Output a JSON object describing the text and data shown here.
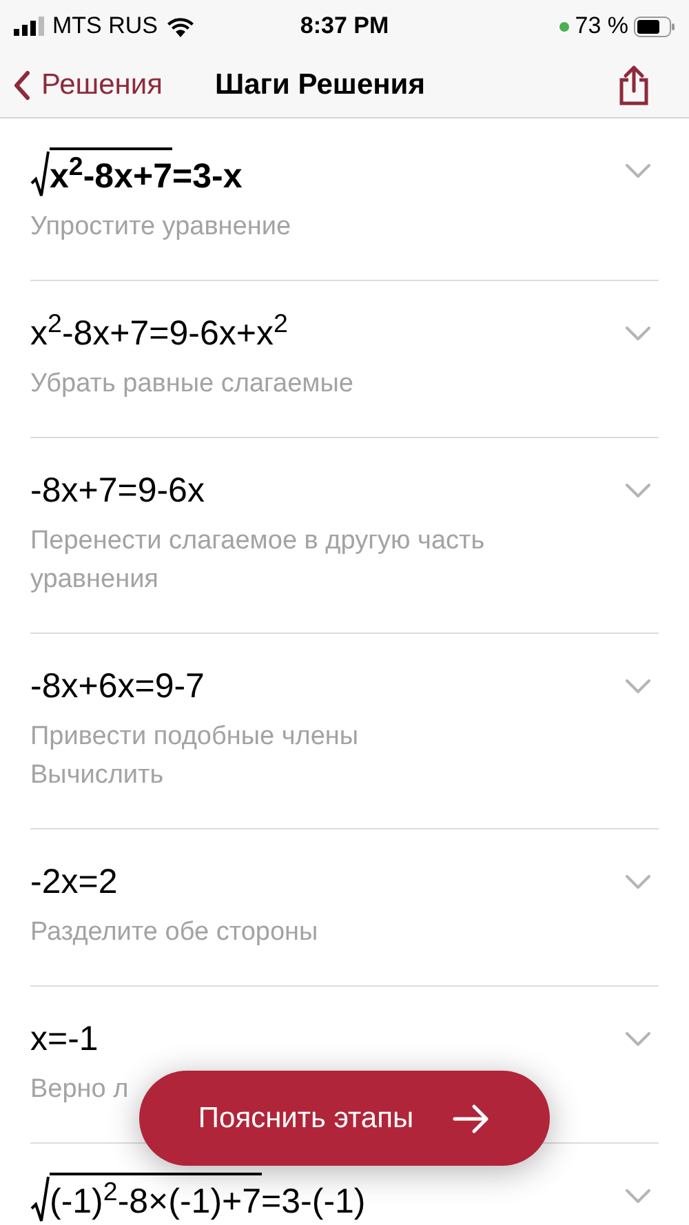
{
  "status_bar": {
    "carrier": "MTS RUS",
    "time": "8:37 PM",
    "battery": "73 %"
  },
  "nav": {
    "back": "Решения",
    "title": "Шаги Решения"
  },
  "steps": [
    {
      "radical": "x$^{2}$-8x+7",
      "equation": "=3-x",
      "bold": true,
      "description": "Упростите уравнение",
      "expanded": false
    },
    {
      "equation": "x$^{2}$-8x+7=9-6x+x$^{2}$",
      "bold": false,
      "description": "Убрать равные слагаемые",
      "expanded": false
    },
    {
      "equation": "-8x+7=9-6x",
      "bold": false,
      "description": "Перенести слагаемое в другую часть уравнения",
      "expanded": false
    },
    {
      "equation": "-8x+6x=9-7",
      "bold": false,
      "description": "Привести подобные члены\nВычислить",
      "expanded": false
    },
    {
      "equation": "-2x=2",
      "bold": false,
      "description": "Разделите обе стороны",
      "expanded": false
    },
    {
      "equation": "x=-1",
      "bold": false,
      "description": "Верно л",
      "expanded": false
    },
    {
      "radical": "(-1)$^{2}$-8×(-1)+7",
      "equation": "=3-(-1)",
      "bold": false,
      "expanded": false
    }
  ],
  "action_button": {
    "label": "Пояснить этапы"
  }
}
